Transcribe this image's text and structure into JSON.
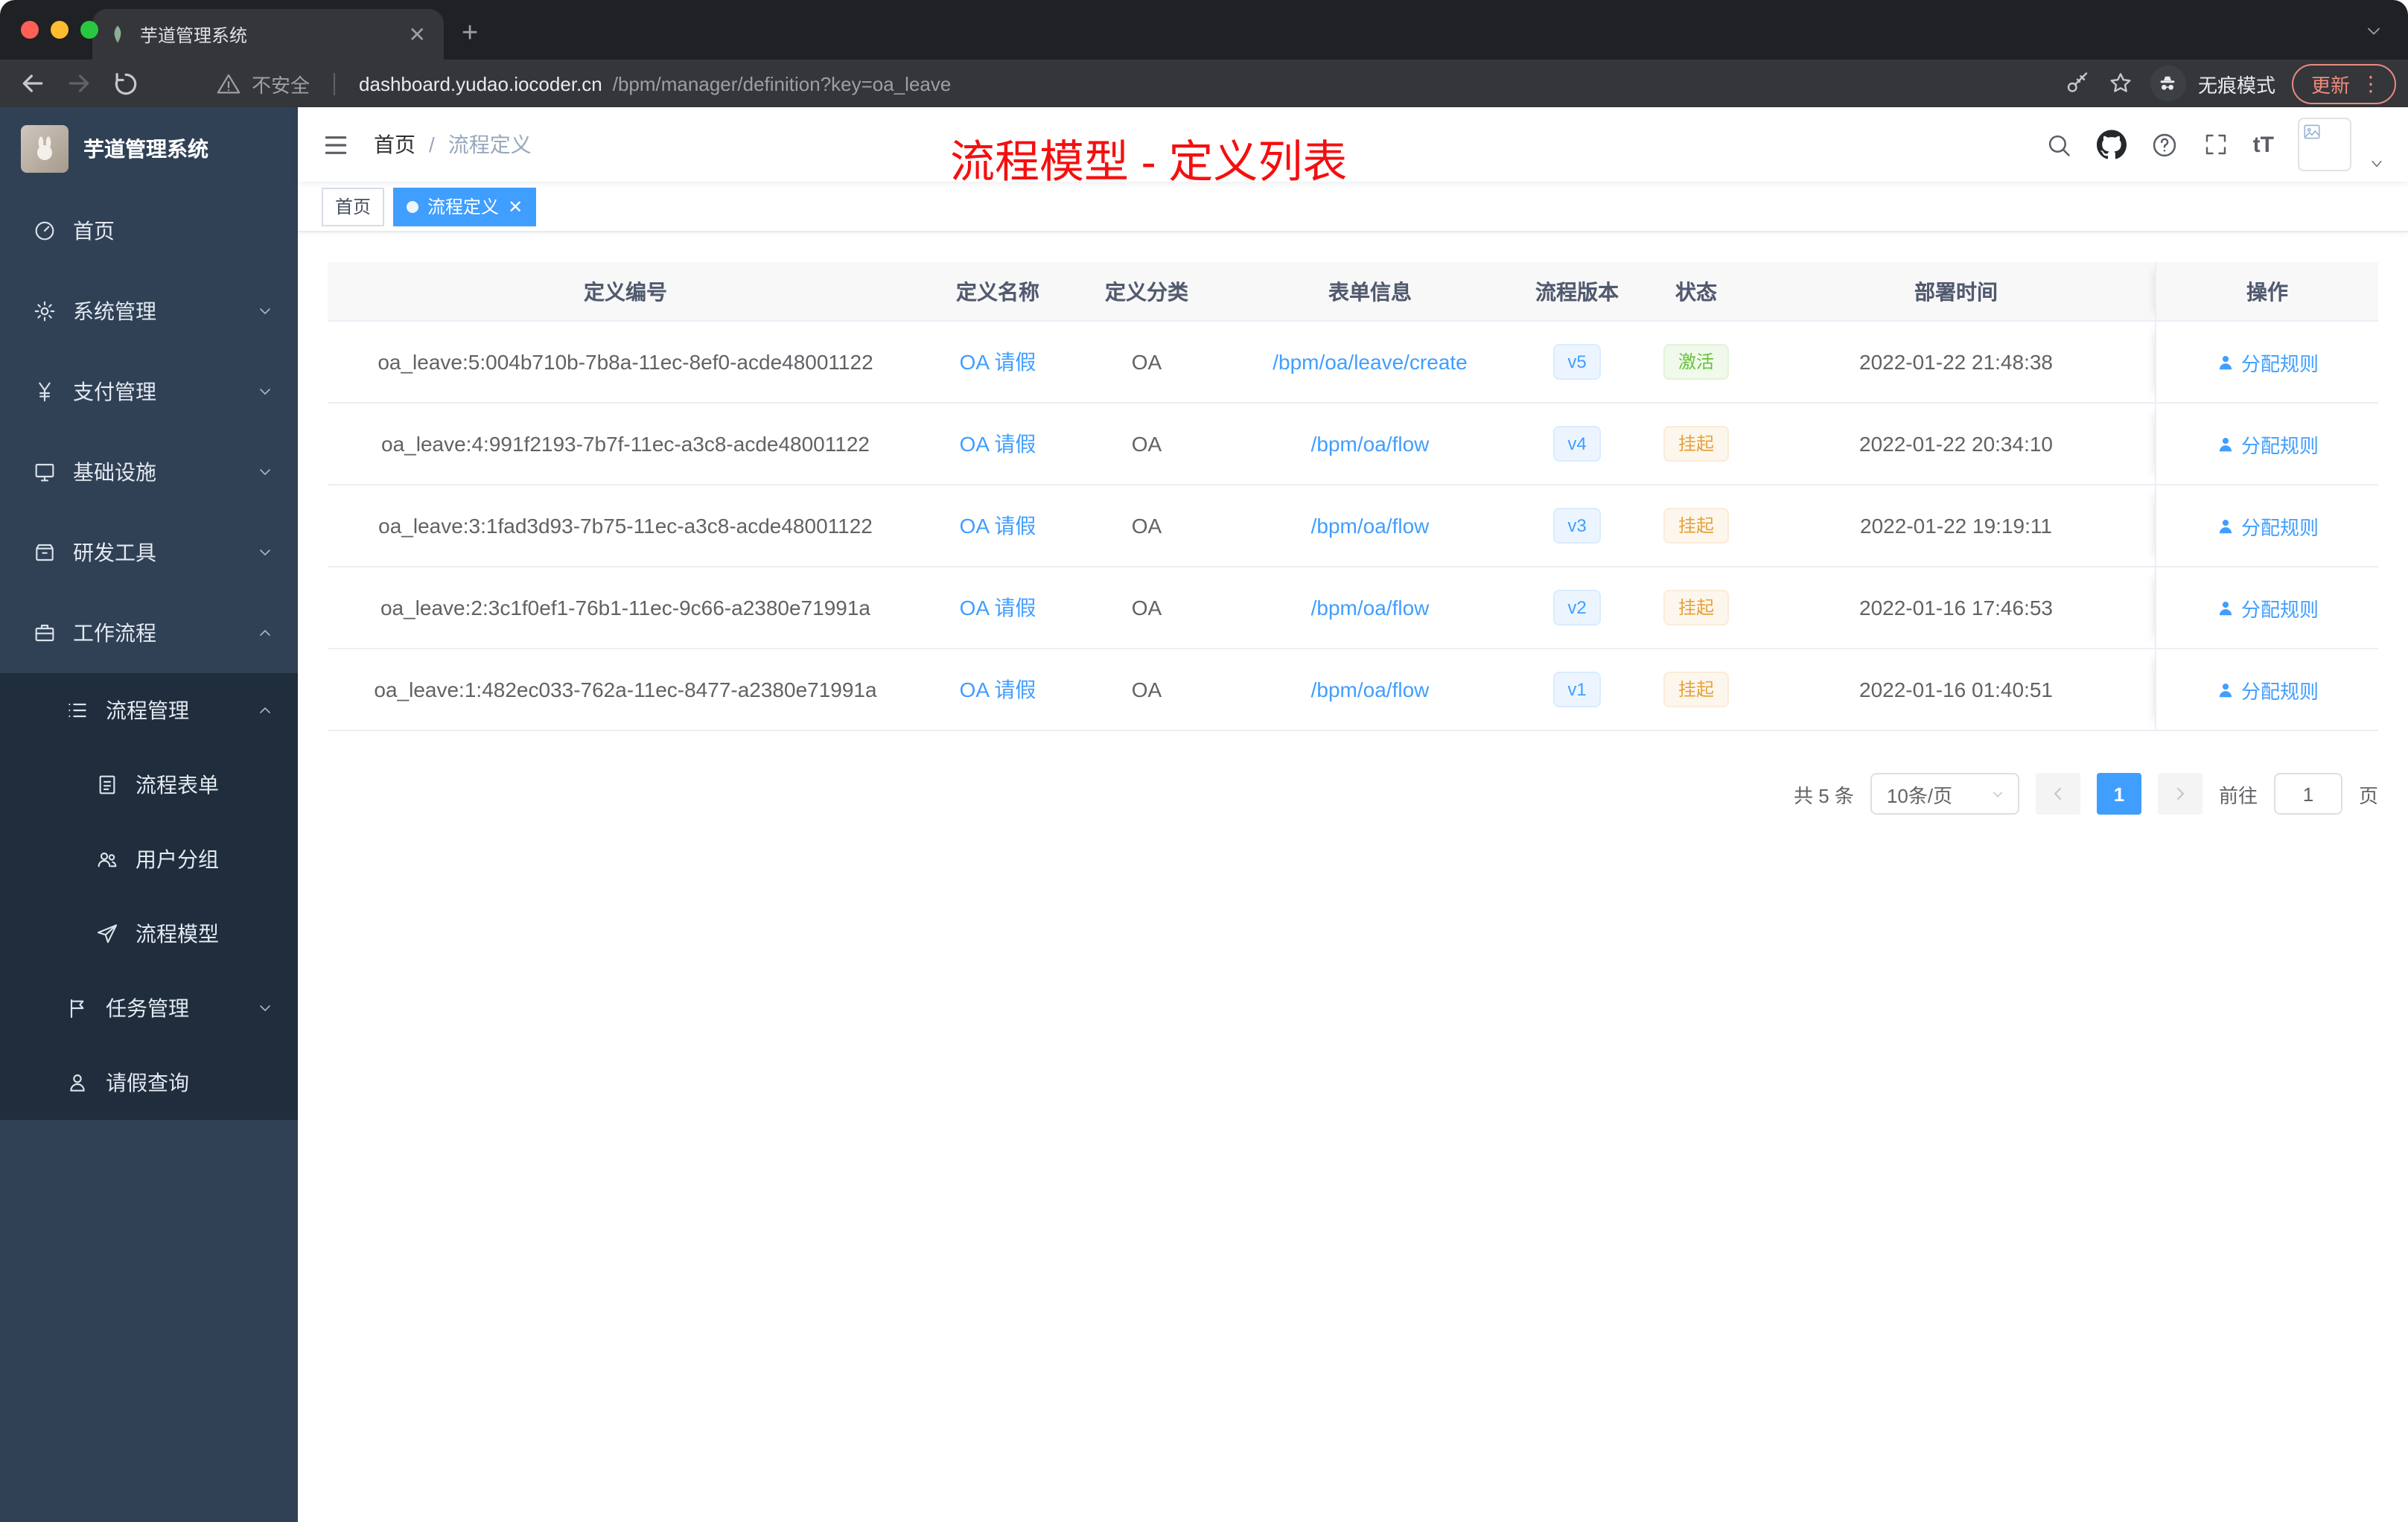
{
  "colors": {
    "accent": "#409eff",
    "success": "#67c23a",
    "warning": "#e6a23c",
    "annotation_red": "#f50f0f",
    "sidebar_bg": "#304156",
    "submenu_bg": "#1f2d3d"
  },
  "browser": {
    "tab_title": "芋道管理系统",
    "security_label": "不安全",
    "url_host": "dashboard.yudao.iocoder.cn",
    "url_path": "/bpm/manager/definition?key=oa_leave",
    "incognito_label": "无痕模式",
    "update_label": "更新"
  },
  "sidebar": {
    "logo_title": "芋道管理系统",
    "home": "首页",
    "system": "系统管理",
    "payment": "支付管理",
    "infra": "基础设施",
    "devtools": "研发工具",
    "workflow": "工作流程",
    "process_mgmt": "流程管理",
    "process_form": "流程表单",
    "user_group": "用户分组",
    "process_model": "流程模型",
    "task_mgmt": "任务管理",
    "leave_query": "请假查询"
  },
  "header": {
    "breadcrumb_home": "首页",
    "breadcrumb_separator": "/",
    "breadcrumb_current": "流程定义",
    "font_size_icon_label": "tT",
    "annotation": "流程模型 - 定义列表"
  },
  "tags": {
    "home": "首页",
    "active": "流程定义"
  },
  "table": {
    "columns": [
      "定义编号",
      "定义名称",
      "定义分类",
      "表单信息",
      "流程版本",
      "状态",
      "部署时间",
      "操作"
    ],
    "rows": [
      {
        "id": "oa_leave:5:004b710b-7b8a-11ec-8ef0-acde48001122",
        "name": "OA 请假",
        "category": "OA",
        "form": "/bpm/oa/leave/create",
        "version": "v5",
        "status": "激活",
        "status_type": "success",
        "time": "2022-01-22 21:48:38",
        "action": "分配规则"
      },
      {
        "id": "oa_leave:4:991f2193-7b7f-11ec-a3c8-acde48001122",
        "name": "OA 请假",
        "category": "OA",
        "form": "/bpm/oa/flow",
        "version": "v4",
        "status": "挂起",
        "status_type": "warning",
        "time": "2022-01-22 20:34:10",
        "action": "分配规则"
      },
      {
        "id": "oa_leave:3:1fad3d93-7b75-11ec-a3c8-acde48001122",
        "name": "OA 请假",
        "category": "OA",
        "form": "/bpm/oa/flow",
        "version": "v3",
        "status": "挂起",
        "status_type": "warning",
        "time": "2022-01-22 19:19:11",
        "action": "分配规则"
      },
      {
        "id": "oa_leave:2:3c1f0ef1-76b1-11ec-9c66-a2380e71991a",
        "name": "OA 请假",
        "category": "OA",
        "form": "/bpm/oa/flow",
        "version": "v2",
        "status": "挂起",
        "status_type": "warning",
        "time": "2022-01-16 17:46:53",
        "action": "分配规则"
      },
      {
        "id": "oa_leave:1:482ec033-762a-11ec-8477-a2380e71991a",
        "name": "OA 请假",
        "category": "OA",
        "form": "/bpm/oa/flow",
        "version": "v1",
        "status": "挂起",
        "status_type": "warning",
        "time": "2022-01-16 01:40:51",
        "action": "分配规则"
      }
    ]
  },
  "pagination": {
    "total": "共 5 条",
    "page_size": "10条/页",
    "current_page": "1",
    "goto_label": "前往",
    "goto_value": "1",
    "unit_label": "页"
  }
}
